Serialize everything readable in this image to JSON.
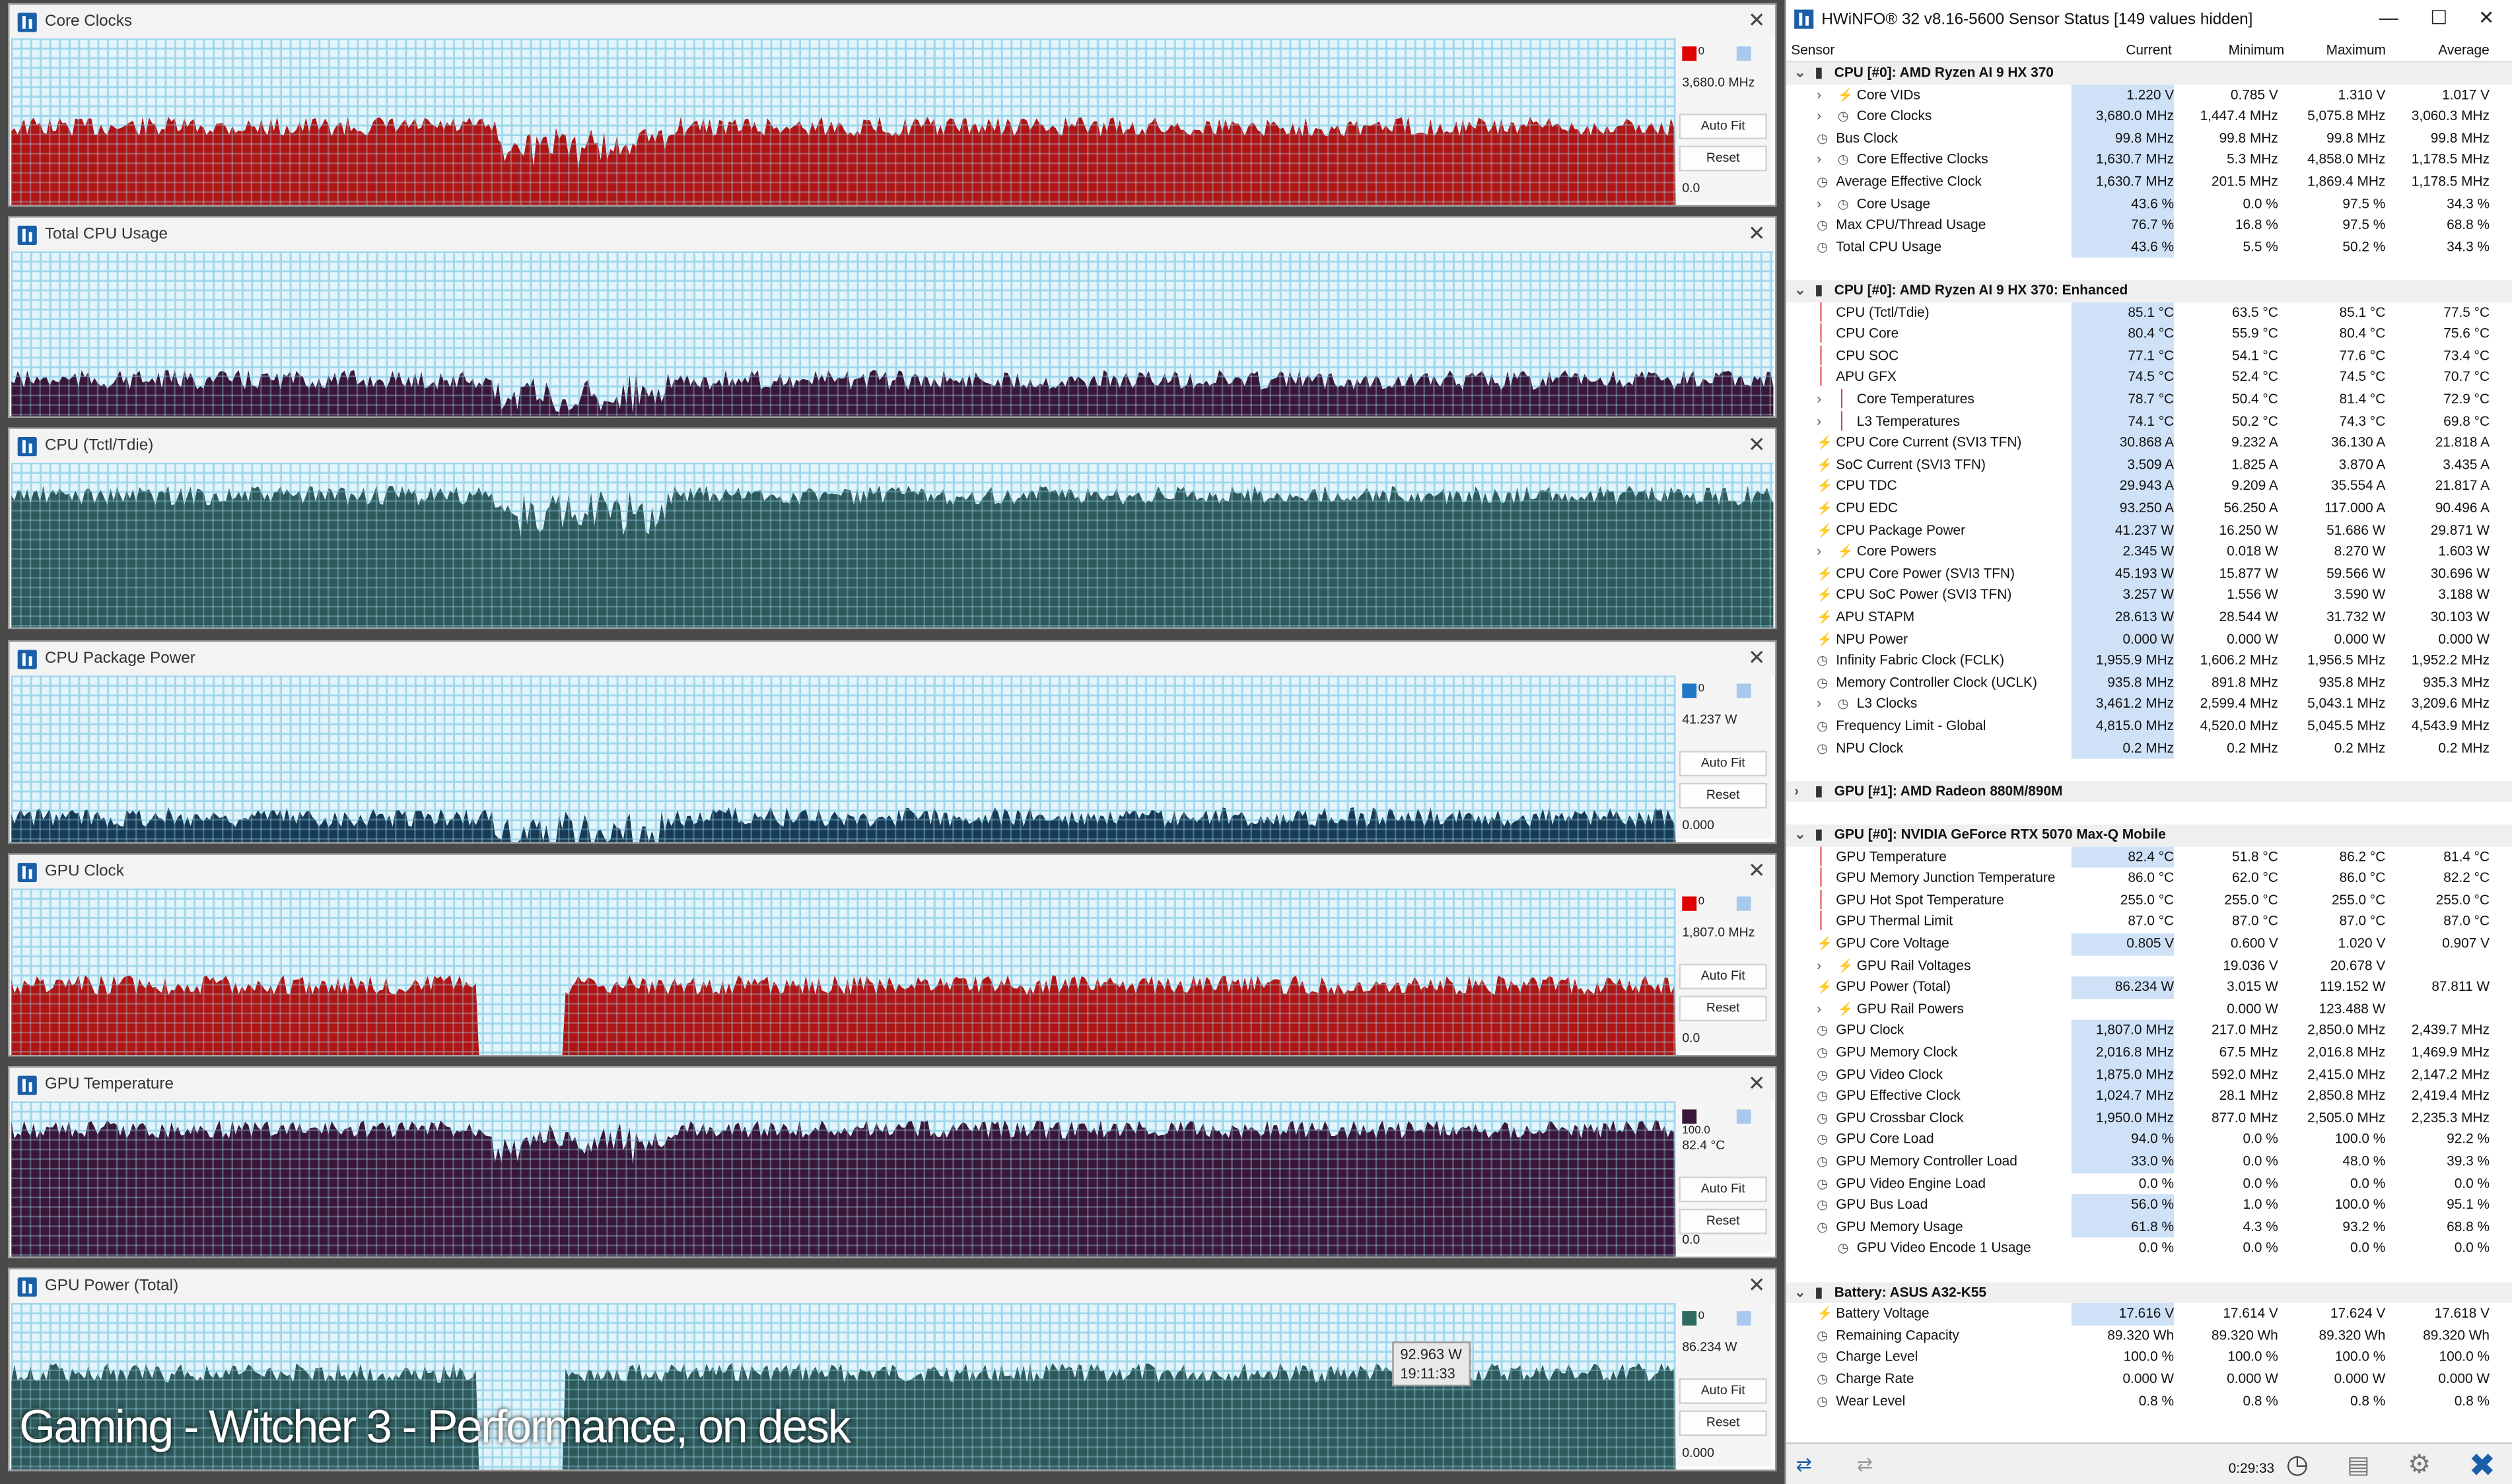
{
  "graphs": [
    {
      "title": "Core Clocks",
      "current": "3,680.0 MHz",
      "min": "0.0",
      "color": "#b01515",
      "swatch": "#e00000",
      "swatch_text": "0",
      "autofit": "Auto Fit",
      "reset": "Reset",
      "level": 0.47
    },
    {
      "title": "Total CPU Usage",
      "current": "",
      "min": "",
      "color": "#3a1738",
      "swatch": "",
      "swatch_text": "",
      "autofit": "",
      "reset": "",
      "level": 0.22
    },
    {
      "title": "CPU (Tctl/Tdie)",
      "current": "",
      "min": "",
      "color": "#2e5a5b",
      "swatch": "",
      "swatch_text": "",
      "autofit": "",
      "reset": "",
      "level": 0.8
    },
    {
      "title": "CPU Package Power",
      "current": "41.237 W",
      "min": "0.000",
      "color": "#173a55",
      "swatch": "#1f79c6",
      "swatch_text": "0",
      "autofit": "Auto Fit",
      "reset": "Reset",
      "level": 0.15
    },
    {
      "title": "GPU Clock",
      "current": "1,807.0 MHz",
      "min": "0.0",
      "color": "#b01515",
      "swatch": "#e00000",
      "swatch_text": "0",
      "autofit": "Auto Fit",
      "reset": "Reset",
      "level": 0.42
    },
    {
      "title": "GPU Temperature",
      "current": "82.4 °C",
      "min": "0.0",
      "max": "100.0",
      "color": "#3a1738",
      "swatch": "#3a1738",
      "swatch_text": "",
      "autofit": "Auto Fit",
      "reset": "Reset",
      "level": 0.82
    },
    {
      "title": "GPU Power (Total)",
      "current": "86.234 W",
      "min": "0.000",
      "color": "#2e5a5b",
      "swatch": "#2e6b63",
      "swatch_text": "0",
      "autofit": "Auto Fit",
      "reset": "Reset",
      "level": 0.58
    }
  ],
  "tooltip": {
    "value": "92.963 W",
    "time": "19:11:33"
  },
  "caption": "Gaming - Witcher 3 - Performance, on desk",
  "hw": {
    "title": "HWiNFO® 32 v8.16-5600 Sensor Status [149 values hidden]",
    "headers": {
      "sensor": "Sensor",
      "current": "Current",
      "minimum": "Minimum",
      "maximum": "Maximum",
      "average": "Average"
    },
    "rows": [
      {
        "type": "group",
        "name": "CPU [#0]: AMD Ryzen AI 9 HX 370"
      },
      {
        "name": "Core VIDs",
        "icon": "bolt",
        "indent": 2,
        "exp": true,
        "v": [
          "1.220 V",
          "0.785 V",
          "1.310 V",
          "1.017 V"
        ]
      },
      {
        "name": "Core Clocks",
        "icon": "clk",
        "indent": 2,
        "exp": true,
        "v": [
          "3,680.0 MHz",
          "1,447.4 MHz",
          "5,075.8 MHz",
          "3,060.3 MHz"
        ]
      },
      {
        "name": "Bus Clock",
        "icon": "clk",
        "indent": 1,
        "v": [
          "99.8 MHz",
          "99.8 MHz",
          "99.8 MHz",
          "99.8 MHz"
        ]
      },
      {
        "name": "Core Effective Clocks",
        "icon": "clk",
        "indent": 2,
        "exp": true,
        "v": [
          "1,630.7 MHz",
          "5.3 MHz",
          "4,858.0 MHz",
          "1,178.5 MHz"
        ]
      },
      {
        "name": "Average Effective Clock",
        "icon": "clk",
        "indent": 1,
        "v": [
          "1,630.7 MHz",
          "201.5 MHz",
          "1,869.4 MHz",
          "1,178.5 MHz"
        ]
      },
      {
        "name": "Core Usage",
        "icon": "clk",
        "indent": 2,
        "exp": true,
        "v": [
          "43.6 %",
          "0.0 %",
          "97.5 %",
          "34.3 %"
        ]
      },
      {
        "name": "Max CPU/Thread Usage",
        "icon": "clk",
        "indent": 1,
        "v": [
          "76.7 %",
          "16.8 %",
          "97.5 %",
          "68.8 %"
        ]
      },
      {
        "name": "Total CPU Usage",
        "icon": "clk",
        "indent": 1,
        "v": [
          "43.6 %",
          "5.5 %",
          "50.2 %",
          "34.3 %"
        ]
      },
      {
        "type": "blank"
      },
      {
        "type": "group",
        "name": "CPU [#0]: AMD Ryzen AI 9 HX 370: Enhanced"
      },
      {
        "name": "CPU (Tctl/Tdie)",
        "icon": "temp",
        "indent": 1,
        "v": [
          "85.1 °C",
          "63.5 °C",
          "85.1 °C",
          "77.5 °C"
        ]
      },
      {
        "name": "CPU Core",
        "icon": "temp",
        "indent": 1,
        "v": [
          "80.4 °C",
          "55.9 °C",
          "80.4 °C",
          "75.6 °C"
        ]
      },
      {
        "name": "CPU SOC",
        "icon": "temp",
        "indent": 1,
        "v": [
          "77.1 °C",
          "54.1 °C",
          "77.6 °C",
          "73.4 °C"
        ]
      },
      {
        "name": "APU GFX",
        "icon": "temp",
        "indent": 1,
        "v": [
          "74.5 °C",
          "52.4 °C",
          "74.5 °C",
          "70.7 °C"
        ]
      },
      {
        "name": "Core Temperatures",
        "icon": "temp",
        "indent": 2,
        "exp": true,
        "v": [
          "78.7 °C",
          "50.4 °C",
          "81.4 °C",
          "72.9 °C"
        ]
      },
      {
        "name": "L3 Temperatures",
        "icon": "temp",
        "indent": 2,
        "exp": true,
        "v": [
          "74.1 °C",
          "50.2 °C",
          "74.3 °C",
          "69.8 °C"
        ]
      },
      {
        "name": "CPU Core Current (SVI3 TFN)",
        "icon": "bolt",
        "indent": 1,
        "v": [
          "30.868 A",
          "9.232 A",
          "36.130 A",
          "21.818 A"
        ]
      },
      {
        "name": "SoC Current (SVI3 TFN)",
        "icon": "bolt",
        "indent": 1,
        "v": [
          "3.509 A",
          "1.825 A",
          "3.870 A",
          "3.435 A"
        ]
      },
      {
        "name": "CPU TDC",
        "icon": "bolt",
        "indent": 1,
        "v": [
          "29.943 A",
          "9.209 A",
          "35.554 A",
          "21.817 A"
        ]
      },
      {
        "name": "CPU EDC",
        "icon": "bolt",
        "indent": 1,
        "v": [
          "93.250 A",
          "56.250 A",
          "117.000 A",
          "90.496 A"
        ]
      },
      {
        "name": "CPU Package Power",
        "icon": "bolt",
        "indent": 1,
        "v": [
          "41.237 W",
          "16.250 W",
          "51.686 W",
          "29.871 W"
        ]
      },
      {
        "name": "Core Powers",
        "icon": "bolt",
        "indent": 2,
        "exp": true,
        "v": [
          "2.345 W",
          "0.018 W",
          "8.270 W",
          "1.603 W"
        ]
      },
      {
        "name": "CPU Core Power (SVI3 TFN)",
        "icon": "bolt",
        "indent": 1,
        "v": [
          "45.193 W",
          "15.877 W",
          "59.566 W",
          "30.696 W"
        ]
      },
      {
        "name": "CPU SoC Power (SVI3 TFN)",
        "icon": "bolt",
        "indent": 1,
        "v": [
          "3.257 W",
          "1.556 W",
          "3.590 W",
          "3.188 W"
        ]
      },
      {
        "name": "APU STAPM",
        "icon": "bolt",
        "indent": 1,
        "v": [
          "28.613 W",
          "28.544 W",
          "31.732 W",
          "30.103 W"
        ]
      },
      {
        "name": "NPU Power",
        "icon": "bolt",
        "indent": 1,
        "v": [
          "0.000 W",
          "0.000 W",
          "0.000 W",
          "0.000 W"
        ]
      },
      {
        "name": "Infinity Fabric Clock (FCLK)",
        "icon": "clk",
        "indent": 1,
        "v": [
          "1,955.9 MHz",
          "1,606.2 MHz",
          "1,956.5 MHz",
          "1,952.2 MHz"
        ]
      },
      {
        "name": "Memory Controller Clock (UCLK)",
        "icon": "clk",
        "indent": 1,
        "v": [
          "935.8 MHz",
          "891.8 MHz",
          "935.8 MHz",
          "935.3 MHz"
        ]
      },
      {
        "name": "L3 Clocks",
        "icon": "clk",
        "indent": 2,
        "exp": true,
        "v": [
          "3,461.2 MHz",
          "2,599.4 MHz",
          "5,043.1 MHz",
          "3,209.6 MHz"
        ]
      },
      {
        "name": "Frequency Limit - Global",
        "icon": "clk",
        "indent": 1,
        "v": [
          "4,815.0 MHz",
          "4,520.0 MHz",
          "5,045.5 MHz",
          "4,543.9 MHz"
        ]
      },
      {
        "name": "NPU Clock",
        "icon": "clk",
        "indent": 1,
        "v": [
          "0.2 MHz",
          "0.2 MHz",
          "0.2 MHz",
          "0.2 MHz"
        ]
      },
      {
        "type": "blank"
      },
      {
        "type": "group",
        "name": "GPU [#1]: AMD Radeon 880M/890M",
        "collapsed": true
      },
      {
        "type": "blank"
      },
      {
        "type": "group",
        "name": "GPU [#0]: NVIDIA  GeForce RTX 5070 Max-Q Mobile"
      },
      {
        "name": "GPU Temperature",
        "icon": "temp",
        "indent": 1,
        "v": [
          "82.4 °C",
          "51.8 °C",
          "86.2 °C",
          "81.4 °C"
        ]
      },
      {
        "name": "GPU Memory Junction Temperature",
        "icon": "temp",
        "indent": 1,
        "v": [
          "86.0 °C",
          "62.0 °C",
          "86.0 °C",
          "82.2 °C"
        ],
        "plain": true
      },
      {
        "name": "GPU Hot Spot Temperature",
        "icon": "temp",
        "indent": 1,
        "v": [
          "255.0 °C",
          "255.0 °C",
          "255.0 °C",
          "255.0 °C"
        ],
        "plain": true
      },
      {
        "name": "GPU Thermal Limit",
        "icon": "temp",
        "indent": 1,
        "v": [
          "87.0 °C",
          "87.0 °C",
          "87.0 °C",
          "87.0 °C"
        ],
        "plain": true
      },
      {
        "name": "GPU Core Voltage",
        "icon": "bolt",
        "indent": 1,
        "v": [
          "0.805 V",
          "0.600 V",
          "1.020 V",
          "0.907 V"
        ]
      },
      {
        "name": "GPU Rail Voltages",
        "icon": "bolt",
        "indent": 2,
        "exp": true,
        "v": [
          "",
          "19.036 V",
          "20.678 V",
          ""
        ],
        "plain": true
      },
      {
        "name": "GPU Power (Total)",
        "icon": "bolt",
        "indent": 1,
        "v": [
          "86.234 W",
          "3.015 W",
          "119.152 W",
          "87.811 W"
        ]
      },
      {
        "name": "GPU Rail Powers",
        "icon": "bolt",
        "indent": 2,
        "exp": true,
        "v": [
          "",
          "0.000 W",
          "123.488 W",
          ""
        ],
        "plain": true
      },
      {
        "name": "GPU Clock",
        "icon": "clk",
        "indent": 1,
        "v": [
          "1,807.0 MHz",
          "217.0 MHz",
          "2,850.0 MHz",
          "2,439.7 MHz"
        ]
      },
      {
        "name": "GPU Memory Clock",
        "icon": "clk",
        "indent": 1,
        "v": [
          "2,016.8 MHz",
          "67.5 MHz",
          "2,016.8 MHz",
          "1,469.9 MHz"
        ]
      },
      {
        "name": "GPU Video Clock",
        "icon": "clk",
        "indent": 1,
        "v": [
          "1,875.0 MHz",
          "592.0 MHz",
          "2,415.0 MHz",
          "2,147.2 MHz"
        ]
      },
      {
        "name": "GPU Effective Clock",
        "icon": "clk",
        "indent": 1,
        "v": [
          "1,024.7 MHz",
          "28.1 MHz",
          "2,850.8 MHz",
          "2,419.4 MHz"
        ]
      },
      {
        "name": "GPU Crossbar Clock",
        "icon": "clk",
        "indent": 1,
        "v": [
          "1,950.0 MHz",
          "877.0 MHz",
          "2,505.0 MHz",
          "2,235.3 MHz"
        ]
      },
      {
        "name": "GPU Core Load",
        "icon": "clk",
        "indent": 1,
        "v": [
          "94.0 %",
          "0.0 %",
          "100.0 %",
          "92.2 %"
        ]
      },
      {
        "name": "GPU Memory Controller Load",
        "icon": "clk",
        "indent": 1,
        "v": [
          "33.0 %",
          "0.0 %",
          "48.0 %",
          "39.3 %"
        ]
      },
      {
        "name": "GPU Video Engine Load",
        "icon": "clk",
        "indent": 1,
        "v": [
          "0.0 %",
          "0.0 %",
          "0.0 %",
          "0.0 %"
        ],
        "plain": true
      },
      {
        "name": "GPU Bus Load",
        "icon": "clk",
        "indent": 1,
        "v": [
          "56.0 %",
          "1.0 %",
          "100.0 %",
          "95.1 %"
        ]
      },
      {
        "name": "GPU Memory Usage",
        "icon": "clk",
        "indent": 1,
        "v": [
          "61.8 %",
          "4.3 %",
          "93.2 %",
          "68.8 %"
        ]
      },
      {
        "name": "GPU Video Encode 1 Usage",
        "icon": "clk",
        "indent": 2,
        "v": [
          "0.0 %",
          "0.0 %",
          "0.0 %",
          "0.0 %"
        ],
        "plain": true
      },
      {
        "type": "blank"
      },
      {
        "type": "group",
        "name": "Battery: ASUS  A32-K55"
      },
      {
        "name": "Battery Voltage",
        "icon": "bolt",
        "indent": 1,
        "v": [
          "17.616 V",
          "17.614 V",
          "17.624 V",
          "17.618 V"
        ]
      },
      {
        "name": "Remaining Capacity",
        "icon": "clk",
        "indent": 1,
        "v": [
          "89.320 Wh",
          "89.320 Wh",
          "89.320 Wh",
          "89.320 Wh"
        ],
        "plain": true
      },
      {
        "name": "Charge Level",
        "icon": "clk",
        "indent": 1,
        "v": [
          "100.0 %",
          "100.0 %",
          "100.0 %",
          "100.0 %"
        ],
        "plain": true
      },
      {
        "name": "Charge Rate",
        "icon": "clk",
        "indent": 1,
        "v": [
          "0.000 W",
          "0.000 W",
          "0.000 W",
          "0.000 W"
        ],
        "plain": true
      },
      {
        "name": "Wear Level",
        "icon": "clk",
        "indent": 1,
        "v": [
          "0.8 %",
          "0.8 %",
          "0.8 %",
          "0.8 %"
        ],
        "plain": true
      }
    ],
    "footer": {
      "time": "0:29:33"
    }
  }
}
